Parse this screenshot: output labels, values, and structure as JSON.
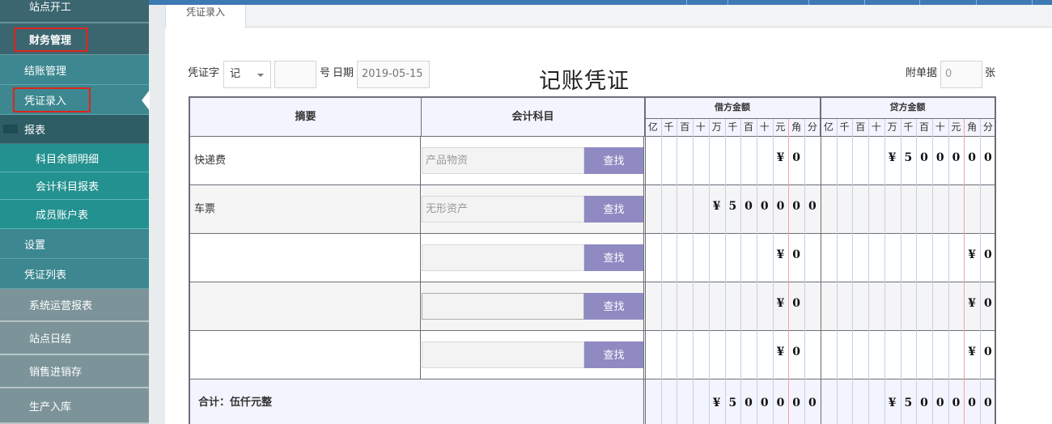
{
  "sidebar": {
    "items": [
      {
        "label": "站点开工",
        "level": "l1"
      },
      {
        "label": "财务管理",
        "level": "l1"
      },
      {
        "label": "结账管理",
        "level": "l2"
      },
      {
        "label": "凭证录入",
        "level": "l2"
      },
      {
        "label": "报表",
        "level": "dark"
      },
      {
        "label": "科目余额明细",
        "level": "l3"
      },
      {
        "label": "会计科目报表",
        "level": "l3"
      },
      {
        "label": "成员账户表",
        "level": "l3"
      },
      {
        "label": "设置",
        "level": "l2"
      },
      {
        "label": "凭证列表",
        "level": "l2"
      },
      {
        "label": "系统运营报表",
        "level": "l0"
      },
      {
        "label": "站点日结",
        "level": "l0"
      },
      {
        "label": "销售进销存",
        "level": "l0"
      },
      {
        "label": "生产入库",
        "level": "l0"
      }
    ]
  },
  "tab": {
    "label": "凭证录入"
  },
  "voucher_form": {
    "word_label": "凭证字",
    "word_value": "记",
    "number_value": "",
    "no_label": "号",
    "date_label": "日期",
    "date_value": "2019-05-15",
    "title": "记账凭证",
    "attach_label": "附单据",
    "attach_value": "0",
    "attach_unit": "张"
  },
  "table": {
    "headers": {
      "summary": "摘要",
      "account": "会计科目",
      "debit": "借方金额",
      "credit": "贷方金额"
    },
    "units": [
      "亿",
      "千",
      "百",
      "十",
      "万",
      "千",
      "百",
      "十",
      "元",
      "角",
      "分"
    ],
    "find_label": "查找",
    "rows": [
      {
        "summary": "快递费",
        "account": "产品物资",
        "debit": [
          "",
          "",
          "",
          "",
          "",
          "",
          "",
          "",
          "¥",
          "0",
          ""
        ],
        "credit": [
          "",
          "",
          "",
          "",
          "¥",
          "5",
          "0",
          "0",
          "0",
          "0",
          "0"
        ]
      },
      {
        "summary": "车票",
        "account": "无形资产",
        "debit": [
          "",
          "",
          "",
          "",
          "¥",
          "5",
          "0",
          "0",
          "0",
          "0",
          "0"
        ],
        "credit": [
          "",
          "",
          "",
          "",
          "",
          "",
          "",
          "",
          "",
          "",
          ""
        ]
      },
      {
        "summary": "",
        "account": "",
        "debit": [
          "",
          "",
          "",
          "",
          "",
          "",
          "",
          "",
          "¥",
          "0",
          ""
        ],
        "credit": [
          "",
          "",
          "",
          "",
          "",
          "",
          "",
          "",
          "",
          "¥",
          "0"
        ]
      },
      {
        "summary": "",
        "account": "",
        "debit": [
          "",
          "",
          "",
          "",
          "",
          "",
          "",
          "",
          "¥",
          "0",
          ""
        ],
        "credit": [
          "",
          "",
          "",
          "",
          "",
          "",
          "",
          "",
          "",
          "¥",
          "0"
        ]
      },
      {
        "summary": "",
        "account": "",
        "debit": [
          "",
          "",
          "",
          "",
          "",
          "",
          "",
          "",
          "¥",
          "0",
          ""
        ],
        "credit": [
          "",
          "",
          "",
          "",
          "",
          "",
          "",
          "",
          "",
          "¥",
          "0"
        ]
      }
    ],
    "total": {
      "label": "合计：伍仟元整",
      "debit": [
        "",
        "",
        "",
        "",
        "¥",
        "5",
        "0",
        "0",
        "0",
        "0",
        "0"
      ],
      "credit": [
        "",
        "",
        "",
        "",
        "¥",
        "5",
        "0",
        "0",
        "0",
        "0",
        "0"
      ]
    }
  },
  "colors": {
    "find_button": "#8f8ac2",
    "highlight_box": "#e0241b",
    "sidebar": "#3c8790"
  }
}
